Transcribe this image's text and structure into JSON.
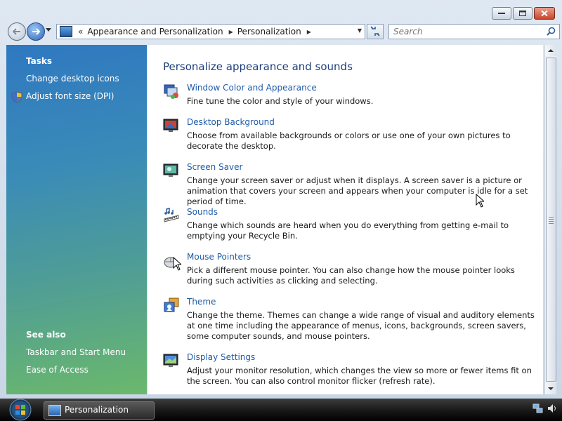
{
  "window": {
    "breadcrumb": [
      "Appearance and Personalization",
      "Personalization"
    ],
    "breadcrumb_overflow": "«"
  },
  "search": {
    "placeholder": "Search"
  },
  "sidebar": {
    "tasks_heading": "Tasks",
    "tasks": [
      {
        "label": "Change desktop icons"
      },
      {
        "label": "Adjust font size (DPI)"
      }
    ],
    "see_also_heading": "See also",
    "see_also": [
      {
        "label": "Taskbar and Start Menu"
      },
      {
        "label": "Ease of Access"
      }
    ]
  },
  "main": {
    "title": "Personalize appearance and sounds",
    "items": [
      {
        "icon": "window-color-icon",
        "title": "Window Color and Appearance",
        "desc": "Fine tune the color and style of your windows."
      },
      {
        "icon": "desktop-background-icon",
        "title": "Desktop Background",
        "desc": "Choose from available backgrounds or colors or use one of your own pictures to decorate the desktop."
      },
      {
        "icon": "screen-saver-icon",
        "title": "Screen Saver",
        "desc": "Change your screen saver or adjust when it displays. A screen saver is a picture or animation that covers your screen and appears when your computer is idle for a set period of time."
      },
      {
        "icon": "sounds-icon",
        "title": "Sounds",
        "desc": "Change which sounds are heard when you do everything from getting e-mail to emptying your Recycle Bin."
      },
      {
        "icon": "mouse-pointers-icon",
        "title": "Mouse Pointers",
        "desc": "Pick a different mouse pointer. You can also change how the mouse pointer looks during such activities as clicking and selecting."
      },
      {
        "icon": "theme-icon",
        "title": "Theme",
        "desc": "Change the theme. Themes can change a wide range of visual and auditory elements at one time including the appearance of menus, icons, backgrounds, screen savers, some computer sounds, and mouse pointers."
      },
      {
        "icon": "display-settings-icon",
        "title": "Display Settings",
        "desc": "Adjust your monitor resolution, which changes the view so more or fewer items fit on the screen. You can also control monitor flicker (refresh rate)."
      }
    ]
  },
  "taskbar": {
    "active_window": "Personalization"
  },
  "colors": {
    "link": "#1e5ba8",
    "title": "#1e3f7a"
  }
}
